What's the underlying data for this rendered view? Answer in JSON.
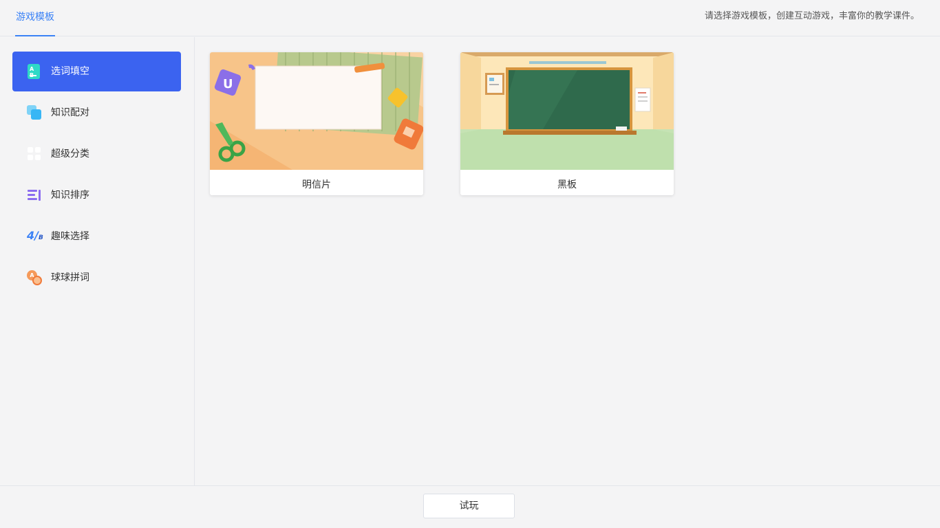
{
  "header": {
    "tab_label": "游戏模板",
    "hint": "请选择游戏模板，创建互动游戏，丰富你的教学课件。"
  },
  "sidebar": {
    "items": [
      {
        "label": "选词填空",
        "icon": "fill-blank-icon",
        "active": true
      },
      {
        "label": "知识配对",
        "icon": "pairing-icon",
        "active": false
      },
      {
        "label": "超级分类",
        "icon": "classify-grid-icon",
        "active": false
      },
      {
        "label": "知识排序",
        "icon": "sort-icon",
        "active": false
      },
      {
        "label": "趣味选择",
        "icon": "ab-choice-icon",
        "active": false
      },
      {
        "label": "球球拼词",
        "icon": "ball-word-icon",
        "active": false
      }
    ]
  },
  "templates": [
    {
      "title": "明信片",
      "thumb": "postcard-thumbnail"
    },
    {
      "title": "黑板",
      "thumb": "blackboard-thumbnail"
    }
  ],
  "footer": {
    "try_label": "试玩"
  },
  "colors": {
    "accent": "#3b63f0",
    "tab_accent": "#3b82f6",
    "background": "#f4f4f5"
  }
}
